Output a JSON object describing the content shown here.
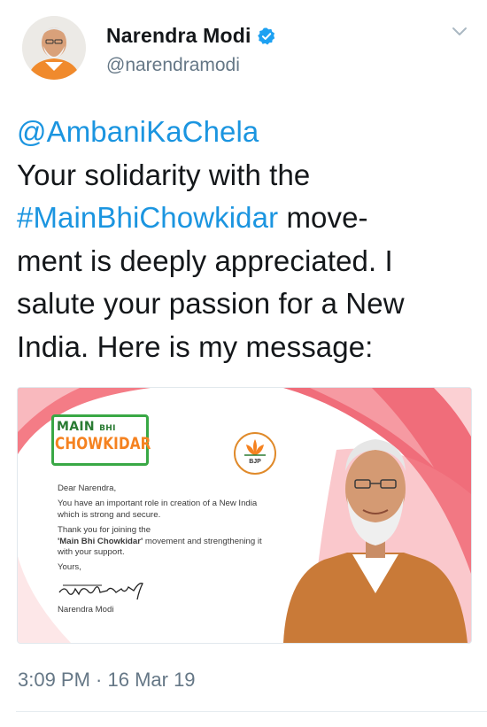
{
  "author": {
    "name": "Narendra Modi",
    "handle": "@narendramodi",
    "verified": true
  },
  "tweet": {
    "mention": "@AmbaniKaChela",
    "line1": "Your solidarity with the",
    "hashtag": "#MainBhiChowkidar",
    "after_hashtag": " move-",
    "line3": "ment is deeply appreciated. I",
    "line4": "salute your passion for a New",
    "line5": "India. Here is my message:"
  },
  "media": {
    "logo_main": "MAIN",
    "logo_bhi": "BHI",
    "logo_chowkidar": "CHOWKIDAR",
    "bjp_label": "BJP",
    "greeting": "Dear Narendra,",
    "para1": "You have an important role in creation of a New India which is strong and secure.",
    "para2_a": "Thank you for joining the",
    "para2_b": "'Main Bhi Chowkidar'",
    "para2_c": " movement and strengthening it with your support.",
    "closing": "Yours,",
    "signer": "Narendra Modi"
  },
  "meta": {
    "timestamp": "3:09 PM · 16 Mar 19"
  },
  "colors": {
    "link": "#1b95e0",
    "text": "#14171a",
    "muted": "#657786",
    "verified": "#1da1f2",
    "banner_pink": "#f06d7a",
    "logo_green": "#39a845",
    "logo_orange": "#f58220"
  }
}
